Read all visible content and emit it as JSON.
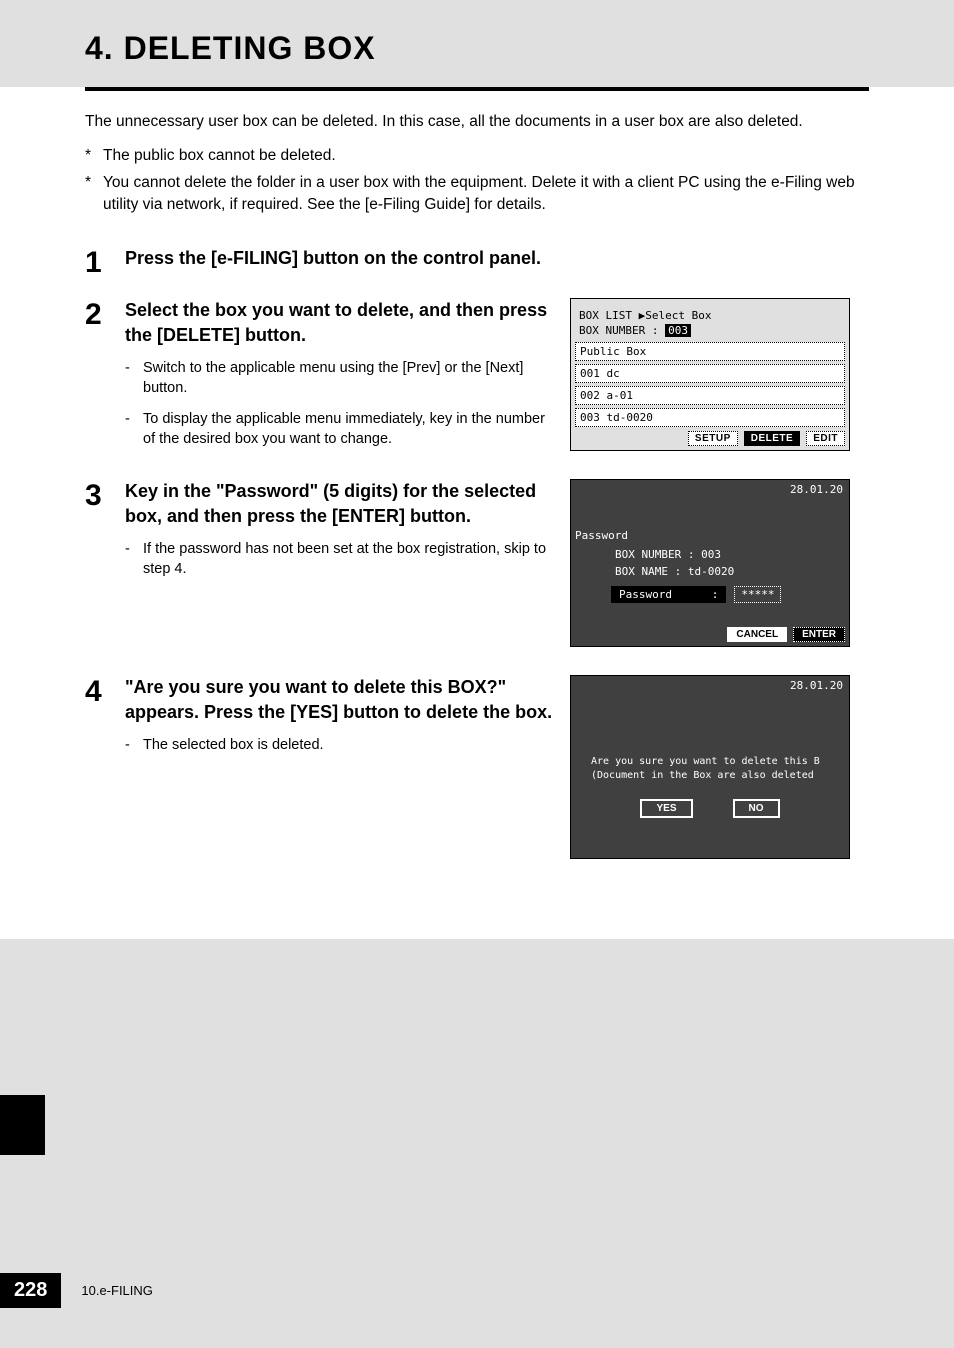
{
  "page_title": "4. DELETING BOX",
  "intro": "The unnecessary user box can be deleted. In this case, all the documents in a user box are also deleted.",
  "notes": [
    "The public box cannot be deleted.",
    "You cannot delete the folder in a user box with the equipment. Delete it with a client PC using the e-Filing web utility via network, if required. See the [e-Filing Guide] for details."
  ],
  "steps": {
    "s1": {
      "num": "1",
      "title": "Press the [e-FILING] button on the control panel."
    },
    "s2": {
      "num": "2",
      "title": "Select the box you want to delete, and then press the [DELETE] button.",
      "sub1": "Switch to the applicable menu using the [Prev] or the [Next] button.",
      "sub2": "To display the applicable menu immediately, key in the number of the desired box you want to change."
    },
    "s3": {
      "num": "3",
      "title": "Key in the \"Password\" (5 digits) for the selected box, and then press the [ENTER] button.",
      "sub1": "If the password has not been set at the box registration, skip to step 4."
    },
    "s4": {
      "num": "4",
      "title": "\"Are you sure you want to delete this BOX?\" appears. Press the [YES] button to delete the box.",
      "sub1": "The selected box is deleted."
    }
  },
  "screenA": {
    "line1": "BOX LIST  ▶Select Box",
    "line2_label": "BOX NUMBER    :",
    "line2_value": "003",
    "item0": "    Public Box",
    "item1": "001 dc",
    "item2": "002 a-01",
    "item3": "003 td-0020",
    "btn_setup": "SETUP",
    "btn_delete": "DELETE",
    "btn_edit": "EDIT"
  },
  "screenB": {
    "date": "28.01.20",
    "label": "Password",
    "boxnum_label": "BOX NUMBER  :  003",
    "boxname_label": "BOX NAME    :  td-0020",
    "pw_label": "Password",
    "pw_dots": "*****",
    "btn_cancel": "CANCEL",
    "btn_enter": "ENTER"
  },
  "screenC": {
    "date": "28.01.20",
    "msg1": "Are you sure you want to delete this B",
    "msg2": "(Document in the Box are also deleted",
    "btn_yes": "YES",
    "btn_no": "NO"
  },
  "footer": {
    "page": "228",
    "section": "10.e-FILING"
  }
}
